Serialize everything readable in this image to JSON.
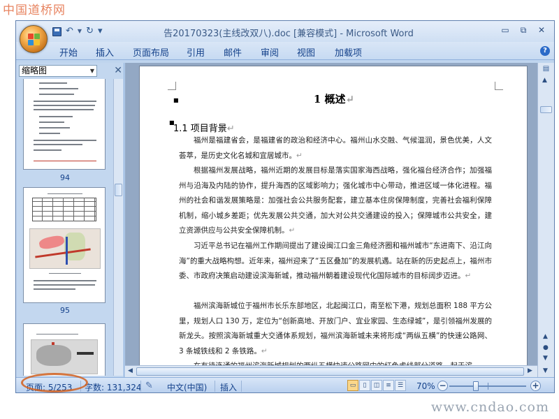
{
  "watermark_top": "中国道桥网",
  "watermark_bottom": "www.cndao.com",
  "title": "告20170323(主线改双八).doc [兼容模式] - Microsoft Word",
  "quick_access": {
    "save": "save-icon",
    "undo": "↶",
    "redo": "↻",
    "customize": "▾"
  },
  "window_controls": {
    "minimize": "▭",
    "restore": "⧉",
    "close": "✕"
  },
  "ribbon_tabs": [
    "开始",
    "插入",
    "页面布局",
    "引用",
    "邮件",
    "审阅",
    "视图",
    "加载项"
  ],
  "help": "?",
  "thumbnail_pane": {
    "view_mode": "缩略图",
    "close": "✕",
    "pages": [
      {
        "number": "94"
      },
      {
        "number": "95"
      }
    ]
  },
  "document": {
    "heading1": "1  概述",
    "heading2": "1.1 项目背景",
    "paragraphs": [
      "福州是福建省会，是福建省的政治和经济中心。福州山水交融、气候温润，景色优美，人文荟萃，是历史文化名城和宜居城市。",
      "根据福州发展战略，福州近期的发展目标是落实国家海西战略，强化福台经济合作；加强福州与沿海及内陆的协作，提升海西的区域影响力；强化城市中心带动，推进区域一体化进程。福州的社会和谐发展策略是：加强社会公共服务配套，建立基本住房保障制度，完善社会福利保障机制，缩小城乡差距；优先发展公共交通，加大对公共交通建设的投入；保障城市公共安全，建立资源供应与公共安全保障机制。",
      "习近平总书记在福州工作期间提出了建设闽江口金三角经济圈和福州城市“东进南下、沿江向海”的重大战略构想。近年来，福州迎来了“五区叠加”的发展机遇。站在新的历史起点上，福州市委、市政府决策启动建设滨海新城，推动福州朝着建设现代化国际城市的目标阔步迈进。",
      "福州滨海新城位于福州市长乐东部地区，北起闽江口，南至松下港，规划总面积 188 平方公里，规划人口 130 万，定位为“创新高地、开放门户、宜业家园、生态绿城”，是引领福州发展的新龙头。按照滨海新城重大交通体系规划，福州滨海新城未来将形成“两纵五横”的快速公路网、3 条城铁线和 2 条铁路。",
      "在有待连通的福州滨海新城规划的两纵五横快速公路网中的红色虚线部分道路，起于滨"
    ]
  },
  "status_bar": {
    "page": "页面: 5/253",
    "words": "字数: 131,324",
    "language": "中文(中国)",
    "mode": "插入",
    "zoom": "70%",
    "zoom_minus": "−",
    "zoom_plus": "+",
    "zoom_level_percent": 70
  },
  "colors": {
    "annotation_ellipse": "#d2601e",
    "ribbon_text": "#15428b",
    "frame": "#bfd5ee"
  }
}
